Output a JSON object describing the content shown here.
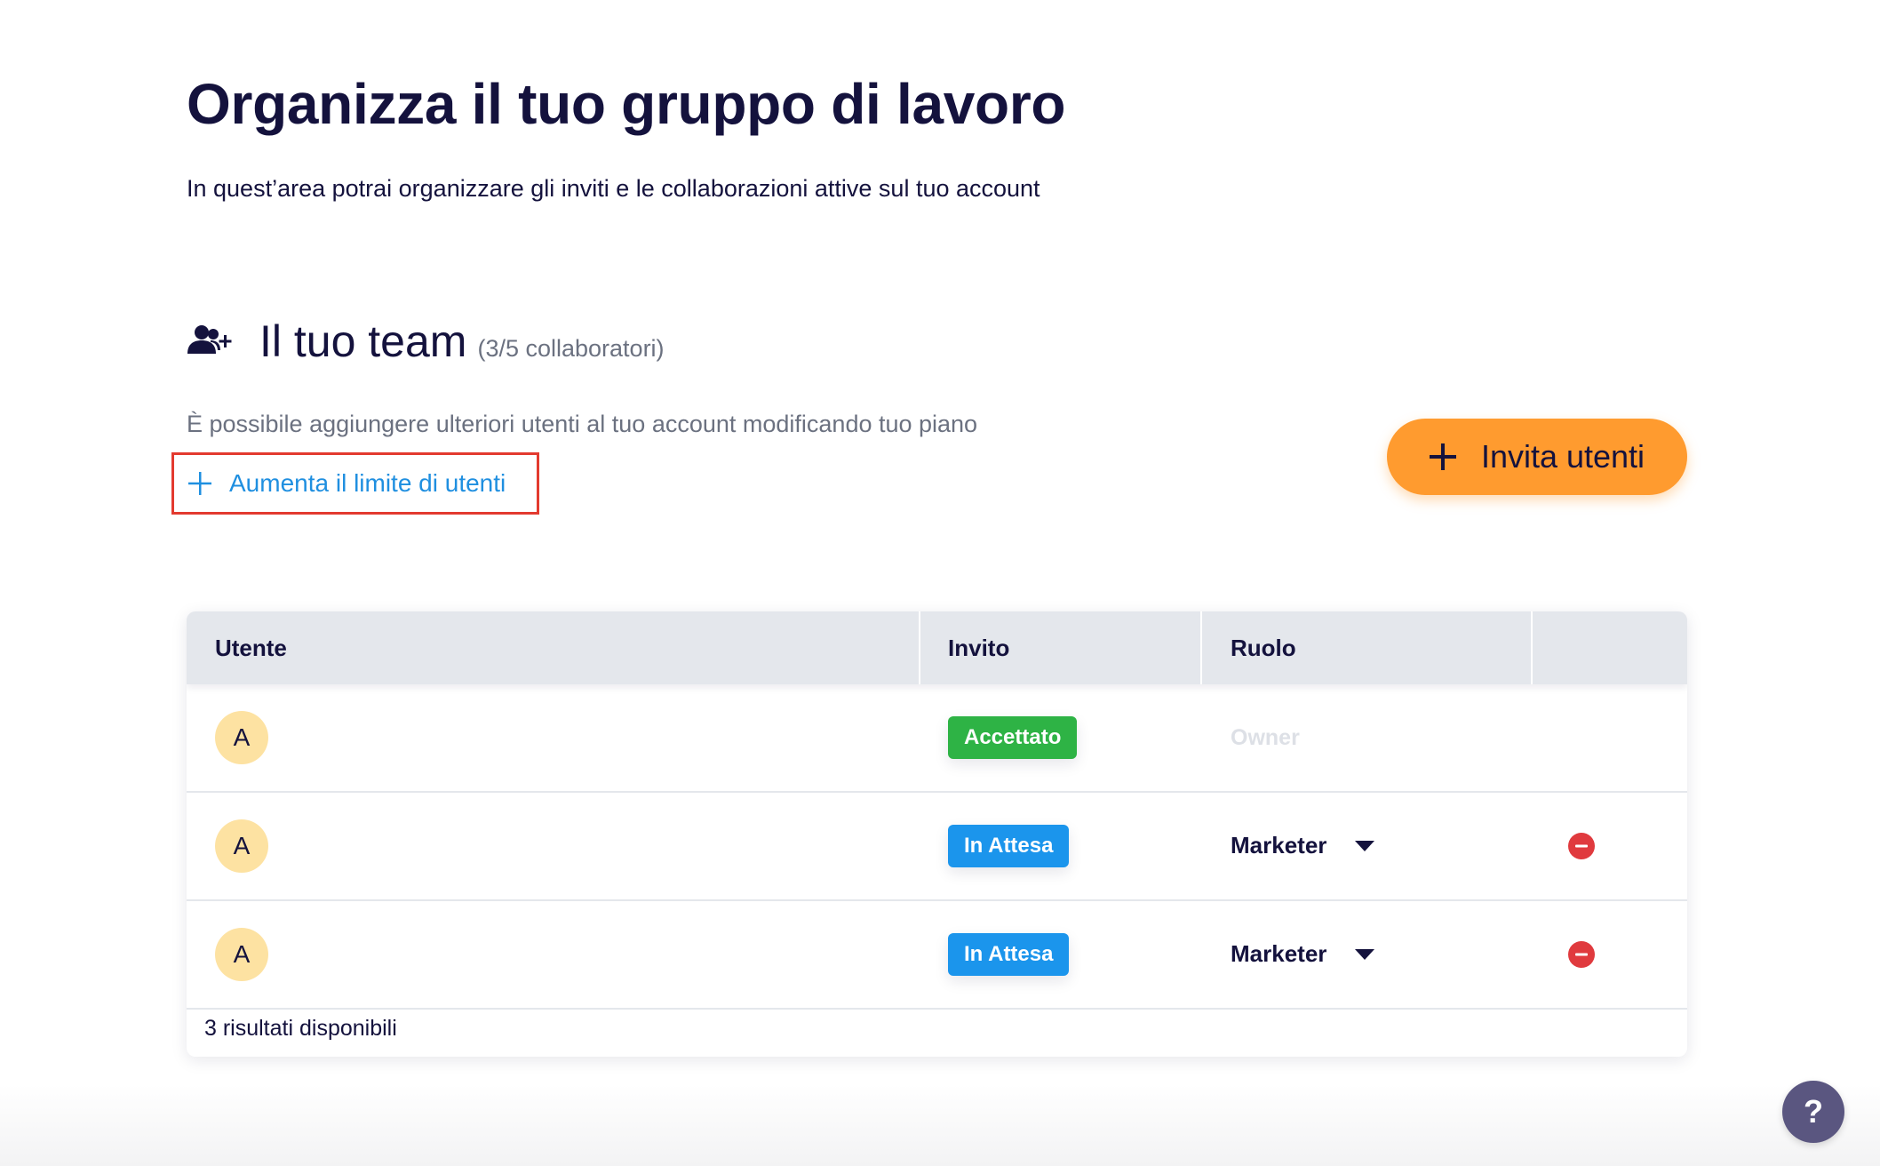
{
  "header": {
    "title": "Organizza il tuo gruppo di lavoro",
    "subtitle": "In quest’area potrai organizzare gli inviti e le collaborazioni attive sul tuo account"
  },
  "team": {
    "title": "Il tuo team",
    "count": "(3/5 collaboratori)",
    "plan_note": "È possibile aggiungere ulteriori utenti al tuo account modificando tuo piano",
    "increase_link": "Aumenta il limite di utenti",
    "invite_button": "Invita utenti",
    "icon": "add-user-icon"
  },
  "table": {
    "columns": [
      "Utente",
      "Invito",
      "Ruolo",
      ""
    ],
    "rows": [
      {
        "avatar": "A",
        "invite_status": "Accettato",
        "status_color": "#2eb345",
        "role": "Owner",
        "editable": false
      },
      {
        "avatar": "A",
        "invite_status": "In Attesa",
        "status_color": "#1b95ec",
        "role": "Marketer",
        "editable": true
      },
      {
        "avatar": "A",
        "invite_status": "In Attesa",
        "status_color": "#1b95ec",
        "role": "Marketer",
        "editable": true
      }
    ],
    "footer": "3 risultati disponibili"
  },
  "help": {
    "label": "?"
  },
  "colors": {
    "primary_text": "#14123d",
    "accent_orange": "#ff9b2f",
    "link_blue": "#1f8fe0",
    "highlight_red": "#e33a2f",
    "remove_red": "#e03a3e"
  }
}
